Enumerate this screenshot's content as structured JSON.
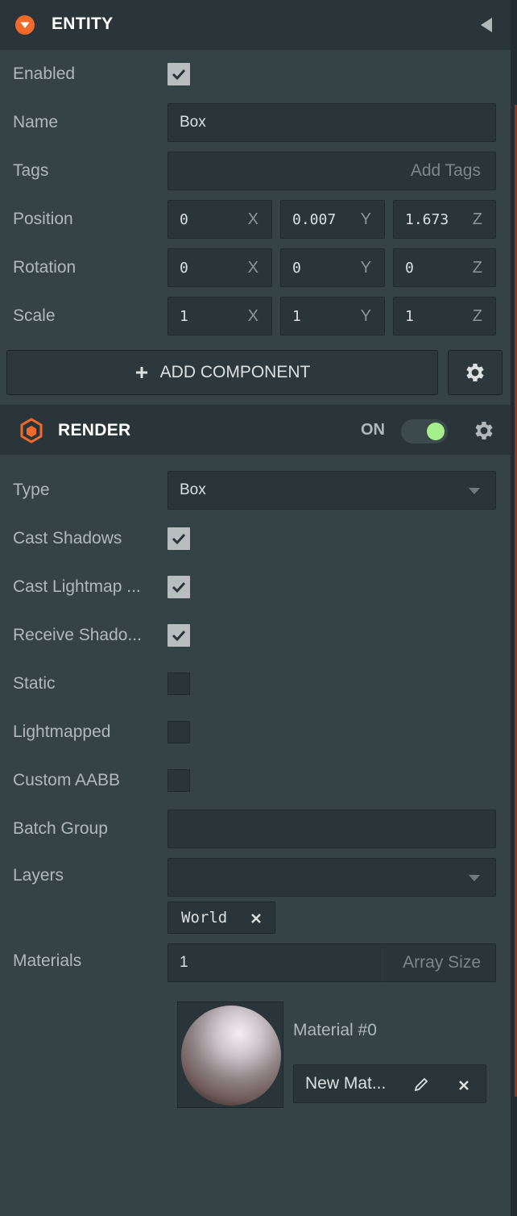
{
  "entity": {
    "title": "ENTITY",
    "enabled_label": "Enabled",
    "enabled": true,
    "name_label": "Name",
    "name_value": "Box",
    "tags_label": "Tags",
    "tags_placeholder": "Add Tags",
    "position_label": "Position",
    "position": [
      "0",
      "0.007",
      "1.673"
    ],
    "rotation_label": "Rotation",
    "rotation": [
      "0",
      "0",
      "0"
    ],
    "scale_label": "Scale",
    "scale": [
      "1",
      "1",
      "1"
    ],
    "axes": [
      "X",
      "Y",
      "Z"
    ],
    "add_component_label": "ADD COMPONENT"
  },
  "render": {
    "title": "RENDER",
    "toggle_label": "ON",
    "toggle_on": true,
    "type_label": "Type",
    "type_value": "Box",
    "cast_shadows_label": "Cast Shadows",
    "cast_shadows": true,
    "cast_lightmap_label": "Cast Lightmap ...",
    "cast_lightmap": true,
    "receive_shadows_label": "Receive Shado...",
    "receive_shadows": true,
    "static_label": "Static",
    "static": false,
    "lightmapped_label": "Lightmapped",
    "lightmapped": false,
    "custom_aabb_label": "Custom AABB",
    "custom_aabb": false,
    "batch_group_label": "Batch Group",
    "batch_group_value": "",
    "layers_label": "Layers",
    "layers_value": "",
    "layer_tag": "World",
    "materials_label": "Materials",
    "materials_count": "1",
    "array_size_placeholder": "Array Size",
    "material_slot_label": "Material #0",
    "material_name": "New Mat..."
  },
  "colors": {
    "accent_orange": "#f26a2a",
    "toggle_green": "#a5f08a",
    "panel_bg": "#364346",
    "header_bg": "#293538"
  },
  "icons": {
    "entity": "collapse-triangle-icon",
    "collapse": "caret-left-icon",
    "render": "hexagon-icon",
    "settings": "gear-icon",
    "check": "check-icon",
    "dropdown": "chevron-down-icon",
    "remove": "close-icon",
    "edit": "pencil-icon",
    "add": "plus-icon"
  }
}
